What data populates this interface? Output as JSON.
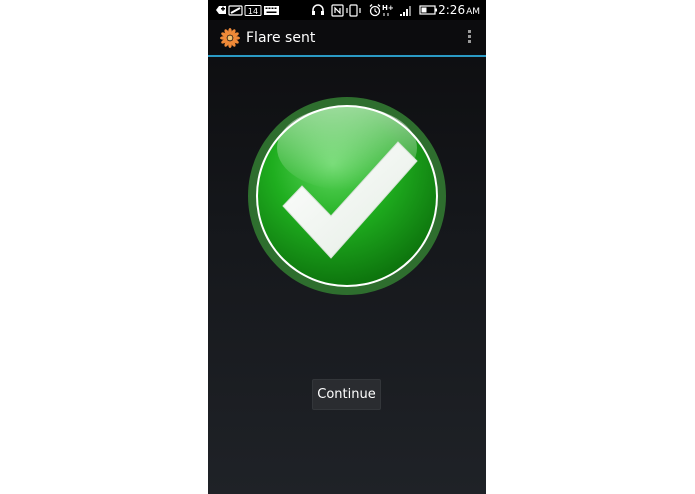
{
  "status_bar": {
    "time": "2:26",
    "ampm": "AM",
    "notification_count": "14",
    "network_type": "H+",
    "icons": [
      "add-icon",
      "app-notification-icon",
      "count-badge",
      "keyboard-icon",
      "headphones-icon",
      "nfc-icon",
      "vibrate-icon",
      "alarm-icon",
      "network-h-plus-icon",
      "signal-icon",
      "battery-icon"
    ]
  },
  "action_bar": {
    "title": "Flare sent",
    "app_icon": "flare-icon",
    "overflow_icon": "overflow-menu-icon",
    "divider_color": "#2a9ac4"
  },
  "content": {
    "status_icon": "check-mark-icon",
    "accent_color": "#1fae1f",
    "continue_label": "Continue"
  }
}
